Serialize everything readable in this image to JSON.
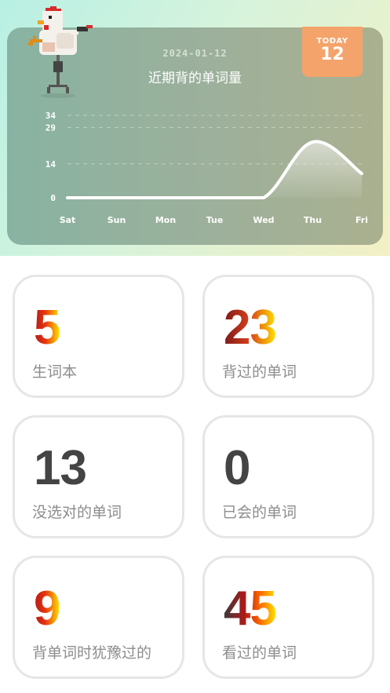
{
  "header": {
    "date": "2024-01-12",
    "title": "近期背的单词量",
    "today_label": "TODAY",
    "today_value": "12"
  },
  "chart_data": {
    "type": "area",
    "title": "近期背的单词量",
    "categories": [
      "Sat",
      "Sun",
      "Mon",
      "Tue",
      "Wed",
      "Thu",
      "Fri"
    ],
    "y_ticks": [
      "0",
      "14",
      "29",
      "34"
    ],
    "series": [
      {
        "values": [
          0,
          0,
          0,
          0,
          0,
          23,
          10
        ]
      }
    ],
    "ylim": [
      0,
      34
    ],
    "grid": true,
    "colors": {
      "line": "#ffffff",
      "grid": "#c9d6c6"
    }
  },
  "stats": [
    {
      "value": "5",
      "label": "生词本",
      "style": "grad"
    },
    {
      "value": "23",
      "label": "背过的单词",
      "style": "grad-dark"
    },
    {
      "value": "13",
      "label": "没选对的单词",
      "style": "plain"
    },
    {
      "value": "0",
      "label": "已会的单词",
      "style": "plain"
    },
    {
      "value": "9",
      "label": "背单词时犹豫过的",
      "style": "grad"
    },
    {
      "value": "45",
      "label": "看过的单词",
      "style": "grad-dark2"
    }
  ]
}
